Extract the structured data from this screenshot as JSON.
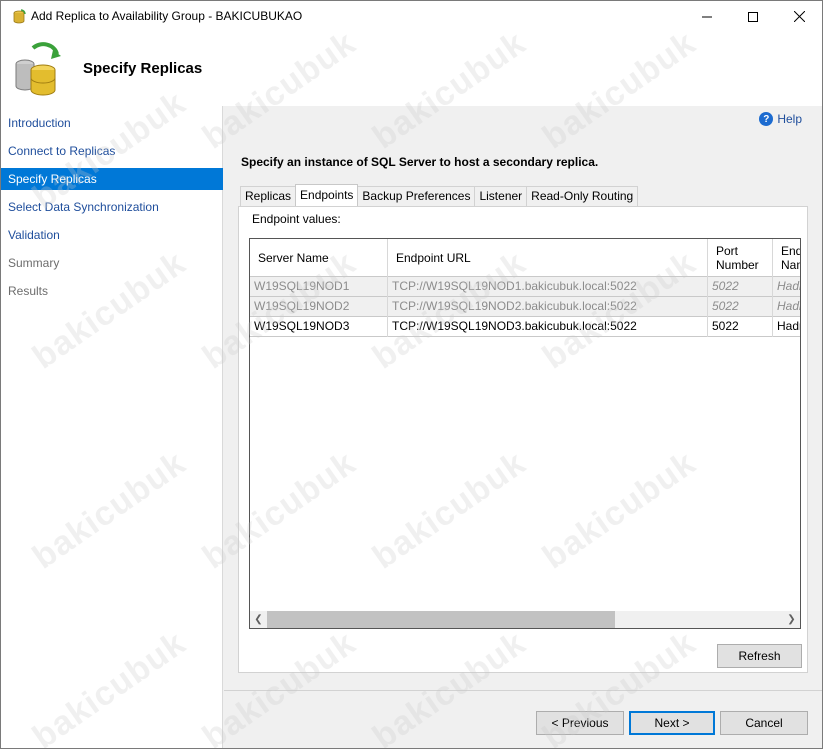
{
  "window": {
    "title": "Add Replica to Availability Group - BAKICUBUKAO",
    "icon": "database-wizard-icon"
  },
  "header": {
    "title": "Specify Replicas",
    "icon": "database-replica-icon"
  },
  "nav": {
    "items": [
      {
        "label": "Introduction",
        "state": "link"
      },
      {
        "label": "Connect to Replicas",
        "state": "link"
      },
      {
        "label": "Specify Replicas",
        "state": "selected"
      },
      {
        "label": "Select Data Synchronization",
        "state": "link"
      },
      {
        "label": "Validation",
        "state": "link"
      },
      {
        "label": "Summary",
        "state": "disabled"
      },
      {
        "label": "Results",
        "state": "disabled"
      }
    ]
  },
  "content": {
    "help_label": "Help",
    "instruction": "Specify an instance of SQL Server to host a secondary replica.",
    "tabs": [
      "Replicas",
      "Endpoints",
      "Backup Preferences",
      "Listener",
      "Read-Only Routing"
    ],
    "active_tab": "Endpoints",
    "panel_label": "Endpoint values:",
    "grid": {
      "columns": [
        "Server Name",
        "Endpoint URL",
        "Port Number",
        "Endpoint Name"
      ],
      "column_display": [
        "Server Name",
        "Endpoint URL",
        "Port\nNumber",
        "End\nNam"
      ],
      "rows": [
        {
          "server": "W19SQL19NOD1",
          "url": "TCP://W19SQL19NOD1.bakicubuk.local:5022",
          "port": "5022",
          "name": "Hadr",
          "enabled": false
        },
        {
          "server": "W19SQL19NOD2",
          "url": "TCP://W19SQL19NOD2.bakicubuk.local:5022",
          "port": "5022",
          "name": "Hadr",
          "enabled": false
        },
        {
          "server": "W19SQL19NOD3",
          "url": "TCP://W19SQL19NOD3.bakicubuk.local:5022",
          "port": "5022",
          "name": "Hadr",
          "enabled": true
        }
      ]
    },
    "refresh_label": "Refresh"
  },
  "footer": {
    "previous_label": "< Previous",
    "next_label": "Next >",
    "cancel_label": "Cancel"
  },
  "watermark": "bakicubuk",
  "colors": {
    "accent": "#0078d7",
    "link": "#1f4e9c",
    "disabled_text": "#8c8c8c"
  }
}
